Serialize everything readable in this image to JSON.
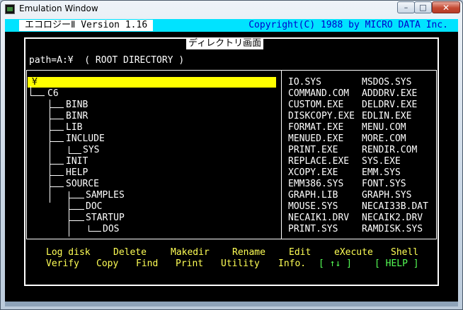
{
  "window": {
    "title": "Emulation Window",
    "min_glyph": "–",
    "max_glyph": "□",
    "close_glyph": "✕"
  },
  "header": {
    "app_name": "エコロジーⅡ Version 1.16",
    "copyright": "Copyright(C) 1988 by MICRO DATA Inc."
  },
  "screen": {
    "caption": "ディレクトリ画面",
    "path": "path=A:¥  ( ROOT DIRECTORY )"
  },
  "tree": [
    {
      "label": "¥",
      "selected": true
    },
    {
      "label": "C6"
    },
    {
      "label": "BINB"
    },
    {
      "label": "BINR"
    },
    {
      "label": "LIB"
    },
    {
      "label": "INCLUDE"
    },
    {
      "label": "SYS"
    },
    {
      "label": "INIT"
    },
    {
      "label": "HELP"
    },
    {
      "label": "SOURCE"
    },
    {
      "label": "SAMPLES"
    },
    {
      "label": "DOC"
    },
    {
      "label": "STARTUP"
    },
    {
      "label": "DOS"
    }
  ],
  "files": [
    [
      "IO.SYS",
      "MSDOS.SYS"
    ],
    [
      "COMMAND.COM",
      "ADDDRV.EXE"
    ],
    [
      "CUSTOM.EXE",
      "DELDRV.EXE"
    ],
    [
      "DISKCOPY.EXE",
      "EDLIN.EXE"
    ],
    [
      "FORMAT.EXE",
      "MENU.COM"
    ],
    [
      "MENUED.EXE",
      "MORE.COM"
    ],
    [
      "PRINT.EXE",
      "RENDIR.COM"
    ],
    [
      "REPLACE.EXE",
      "SYS.EXE"
    ],
    [
      "XCOPY.EXE",
      "EMM.SYS"
    ],
    [
      "EMM386.SYS",
      "FONT.SYS"
    ],
    [
      "GRAPH.LIB",
      "GRAPH.SYS"
    ],
    [
      "MOUSE.SYS",
      "NECAI33B.DAT"
    ],
    [
      "NECAIK1.DRV",
      "NECAIK2.DRV"
    ],
    [
      "PRINT.SYS",
      "RAMDISK.SYS"
    ]
  ],
  "menu": {
    "row1": [
      "Log disk",
      "Delete",
      "Makedir",
      "Rename",
      "Edit",
      "eXecute",
      "Shell"
    ],
    "row2": [
      "Verify",
      "Copy",
      "Find",
      "Print",
      "Utility",
      "Info.",
      "[ ↑↓ ]",
      "[ HELP ]"
    ]
  },
  "colors": {
    "header_bar": "#00e3ff",
    "selection": "#ffff00",
    "menu_text": "#ffff55",
    "menu_hint": "#55ff55",
    "copyright": "#0000cc"
  }
}
